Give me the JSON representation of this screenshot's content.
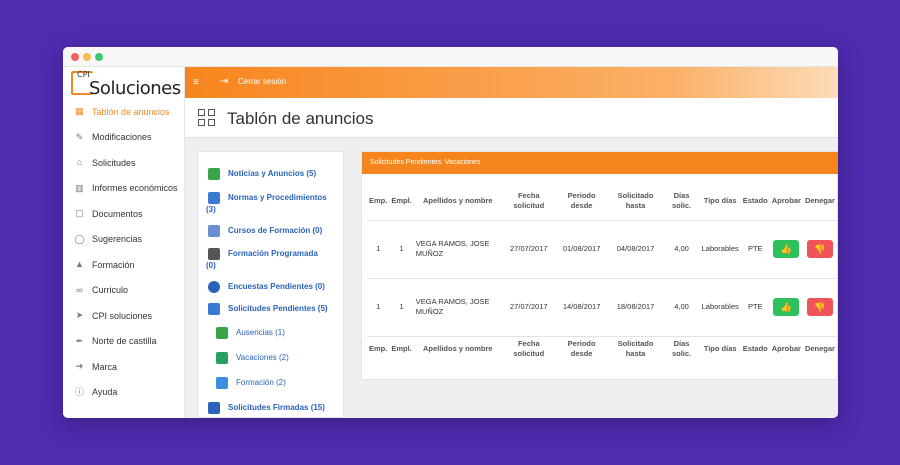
{
  "brand": {
    "cpi": "CPI",
    "name": "Soluciones"
  },
  "sidebar": {
    "items": [
      {
        "label": "Tablón de anuncios",
        "icon": "board-icon",
        "glyph": "▦",
        "active": true
      },
      {
        "label": "Modificaciones",
        "icon": "edit-icon",
        "glyph": "✎",
        "active": false
      },
      {
        "label": "Solicitudes",
        "icon": "inbox-icon",
        "glyph": "⌂",
        "active": false
      },
      {
        "label": "Informes económicos",
        "icon": "bar-chart-icon",
        "glyph": "▥",
        "active": false
      },
      {
        "label": "Documentos",
        "icon": "document-icon",
        "glyph": "▢",
        "active": false
      },
      {
        "label": "Sugerencias",
        "icon": "chat-bubble-icon",
        "glyph": "◯",
        "active": false
      },
      {
        "label": "Formación",
        "icon": "graduation-cap-icon",
        "glyph": "▲",
        "active": false
      },
      {
        "label": "Curriculo",
        "icon": "glasses-icon",
        "glyph": "∞",
        "active": false
      },
      {
        "label": "CPI soluciones",
        "icon": "send-icon",
        "glyph": "➤",
        "active": false
      },
      {
        "label": "Norte de castilla",
        "icon": "pen-icon",
        "glyph": "✒",
        "active": false
      },
      {
        "label": "Marca",
        "icon": "arrow-circle-icon",
        "glyph": "➔",
        "active": false
      },
      {
        "label": "Ayuda",
        "icon": "info-circle-icon",
        "glyph": "ⓘ",
        "active": false
      }
    ]
  },
  "topbar": {
    "menu_glyph": "≡",
    "logout_glyph": "⇥",
    "logout_label": "Cerrar sesión"
  },
  "header": {
    "title": "Tablón de anuncios"
  },
  "left_panel": {
    "items": [
      {
        "label": "Noticias y Anuncios (5)",
        "icon": "news-icon",
        "sub": false
      },
      {
        "label": "Normas y Procedimientos",
        "label2": "(3)",
        "icon": "book-icon",
        "sub": false
      },
      {
        "label": "Cursos de Formación (0)",
        "icon": "course-icon",
        "sub": false
      },
      {
        "label": "Formación Programada",
        "label2": "(0)",
        "icon": "calendar-icon",
        "sub": false
      },
      {
        "label": "Encuestas Pendientes (0)",
        "icon": "question-icon",
        "sub": false
      },
      {
        "label": "Solicitudes Pendientes (5)",
        "icon": "checklist-icon",
        "sub": false
      },
      {
        "label": "Ausencias (1)",
        "icon": "user-absence-icon",
        "sub": true
      },
      {
        "label": "Vacaciones (2)",
        "icon": "map-icon",
        "sub": true
      },
      {
        "label": "Formación (2)",
        "icon": "diploma-icon",
        "sub": true
      },
      {
        "label": "Solicitudes Firmadas (15)",
        "icon": "signed-icon",
        "sub": false
      }
    ]
  },
  "requests": {
    "title": "Solicitudes Pendientes: Vacaciones",
    "columns": [
      "Emp.",
      "Empl.",
      "Apellidos y nombre",
      "Fecha solicitud",
      "Periodo desde",
      "Solicitado hasta",
      "Días solic.",
      "Tipo días",
      "Estado",
      "Aprobar",
      "Denegar"
    ],
    "rows": [
      {
        "emp": "1",
        "empl": "1",
        "name": "VEGA RAMOS, JOSE MUÑOZ",
        "fecha": "27/07/2017",
        "desde": "01/08/2017",
        "hasta": "04/08/2017",
        "dias": "4,00",
        "tipo": "Laborables",
        "estado": "PTE"
      },
      {
        "emp": "1",
        "empl": "1",
        "name": "VEGA RAMOS, JOSE MUÑOZ",
        "fecha": "27/07/2017",
        "desde": "14/08/2017",
        "hasta": "18/08/2017",
        "dias": "4,00",
        "tipo": "Laborables",
        "estado": "PTE"
      }
    ],
    "approve_glyph": "👍",
    "deny_glyph": "👎",
    "colors": {
      "approve": "#2ec05b",
      "deny": "#f0545a",
      "accent": "#f7851d"
    }
  }
}
